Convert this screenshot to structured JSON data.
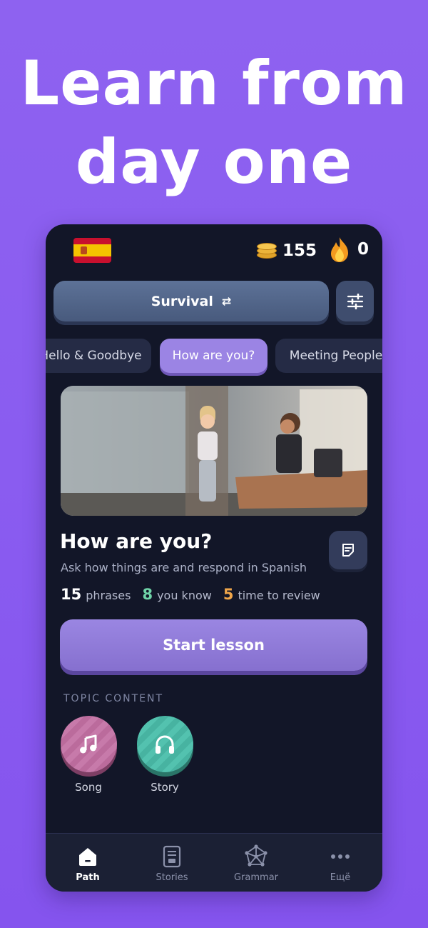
{
  "headline": {
    "line1": "Learn from",
    "line2": "day one"
  },
  "header": {
    "coins": "155",
    "streak": "0",
    "flag": "Spain flag"
  },
  "course": {
    "label": "Survival"
  },
  "tabs": [
    {
      "label": "Hello & Goodbye",
      "active": false
    },
    {
      "label": "How are you?",
      "active": true
    },
    {
      "label": "Meeting People",
      "active": false
    }
  ],
  "lesson": {
    "title": "How are you?",
    "subtitle": "Ask how things are and respond in Spanish",
    "stats": {
      "phrases_count": "15",
      "phrases_label": "phrases",
      "known_count": "8",
      "known_label": "you know",
      "review_count": "5",
      "review_label": "time to review"
    },
    "start_label": "Start lesson"
  },
  "topic_content": {
    "label": "TOPIC CONTENT",
    "items": [
      {
        "label": "Song",
        "icon": "music-note-icon"
      },
      {
        "label": "Story",
        "icon": "headphones-icon"
      }
    ]
  },
  "nav": [
    {
      "label": "Path",
      "icon": "home-icon",
      "active": true
    },
    {
      "label": "Stories",
      "icon": "book-icon",
      "active": false
    },
    {
      "label": "Grammar",
      "icon": "network-icon",
      "active": false
    },
    {
      "label": "Ещё",
      "icon": "more-icon",
      "active": false
    }
  ],
  "colors": {
    "background": "#8a5cf0",
    "phone": "#121628",
    "accent": "#9b84e4",
    "known_green": "#6fd4a8",
    "review_orange": "#f0a64a"
  }
}
